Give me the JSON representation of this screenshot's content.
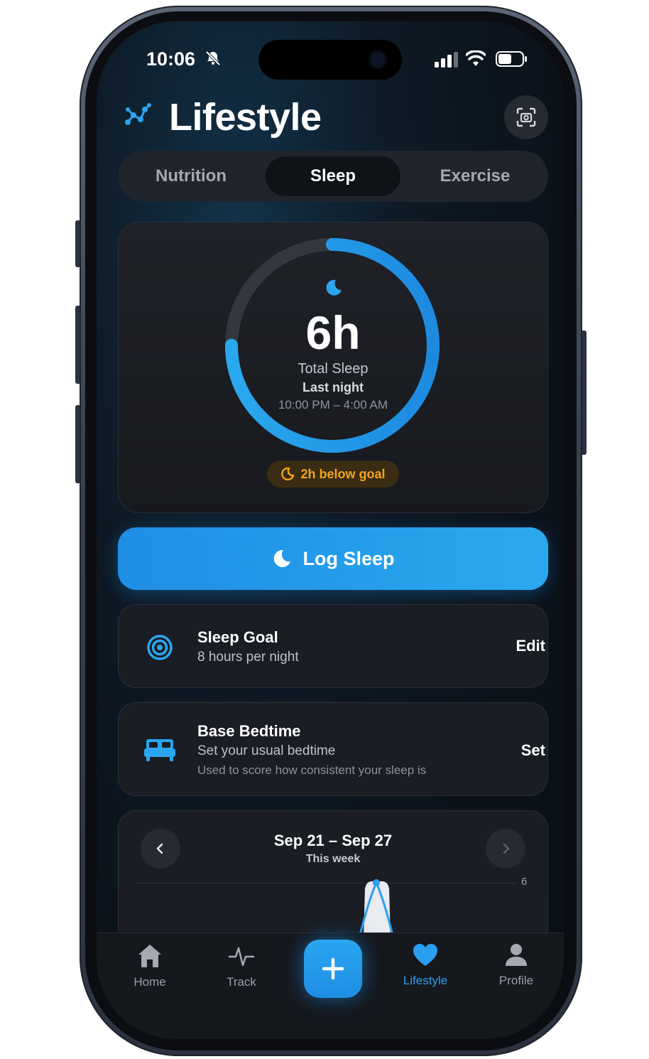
{
  "status_bar": {
    "time": "10:06"
  },
  "header": {
    "title": "Lifestyle"
  },
  "tabs": [
    {
      "label": "Nutrition",
      "active": false
    },
    {
      "label": "Sleep",
      "active": true
    },
    {
      "label": "Exercise",
      "active": false
    }
  ],
  "sleep_summary": {
    "value": "6h",
    "label": "Total Sleep",
    "period": "Last night",
    "time_range": "10:00 PM – 4:00 AM",
    "goal_badge": "2h below goal",
    "progress_fraction": 0.75
  },
  "log_button": {
    "label": "Log Sleep"
  },
  "sleep_goal": {
    "title": "Sleep Goal",
    "subtitle": "8 hours per night",
    "action": "Edit"
  },
  "base_bedtime": {
    "title": "Base Bedtime",
    "subtitle": "Set your usual bedtime",
    "note": "Used to score how consistent your sleep is",
    "action": "Set"
  },
  "week": {
    "range": "Sep 21 – Sep 27",
    "subtitle": "This week",
    "axis_tick": "6"
  },
  "tabbar": {
    "items": [
      {
        "label": "Home",
        "icon": "home-icon"
      },
      {
        "label": "Track",
        "icon": "activity-icon"
      },
      {
        "label": "Lifestyle",
        "icon": "heart-icon",
        "active": true
      },
      {
        "label": "Profile",
        "icon": "person-icon"
      }
    ]
  },
  "colors": {
    "accent": "#2aa6f0",
    "warning": "#f2a419",
    "background": "#0b121a"
  }
}
